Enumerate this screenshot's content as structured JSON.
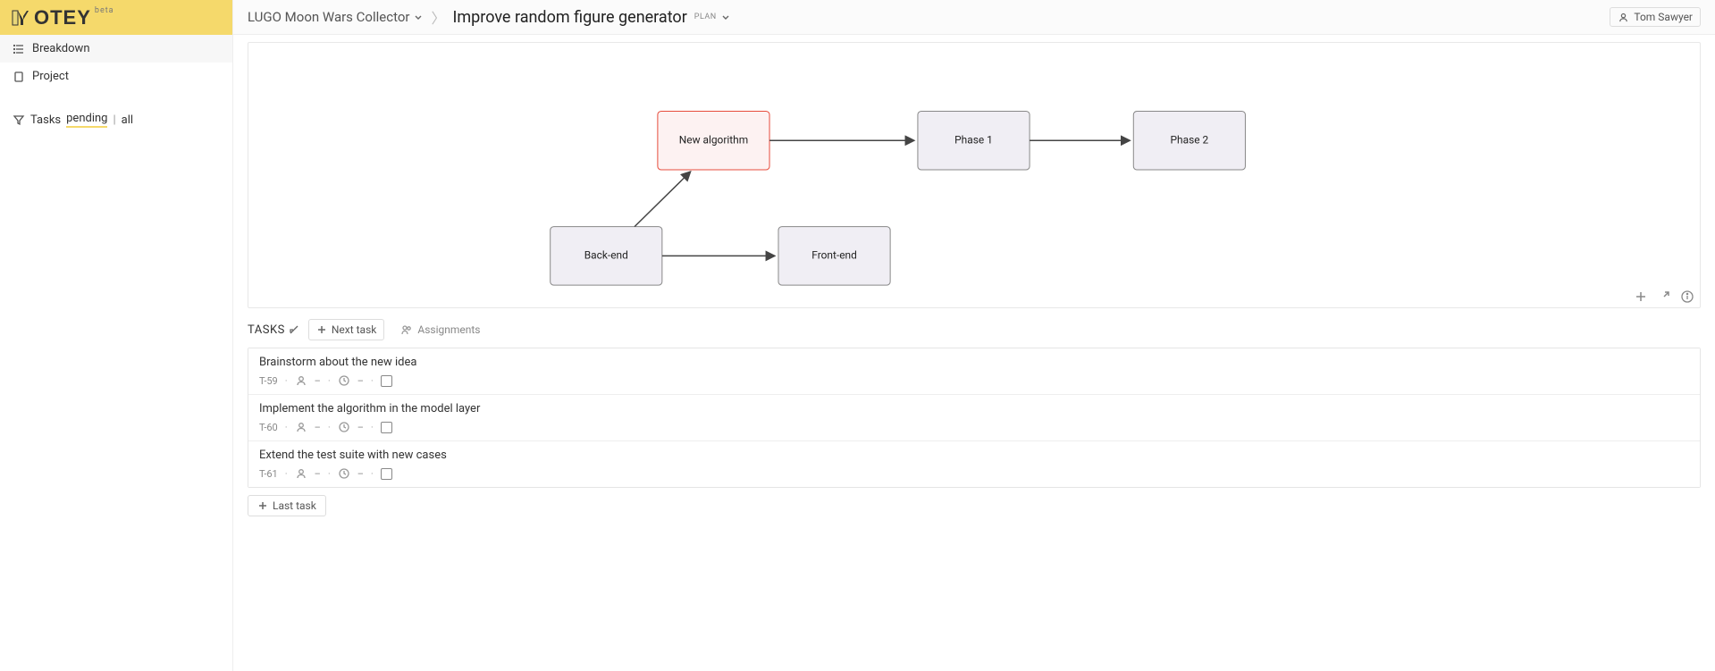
{
  "logo": {
    "text": "OTEY",
    "badge": "beta"
  },
  "sidebar": {
    "items": [
      {
        "label": "Breakdown"
      },
      {
        "label": "Project"
      }
    ],
    "tasks_filter": {
      "label": "Tasks",
      "option_pending": "pending",
      "option_all": "all",
      "divider": "|"
    }
  },
  "breadcrumb": {
    "project": "LUGO Moon Wars Collector",
    "plan": "Improve random figure generator",
    "plan_badge": "PLAN"
  },
  "user": {
    "name": "Tom Sawyer"
  },
  "diagram": {
    "nodes": {
      "backend": "Back-end",
      "frontend": "Front-end",
      "new_algorithm": "New algorithm",
      "phase1": "Phase 1",
      "phase2": "Phase 2"
    }
  },
  "tasks_panel": {
    "title": "TASKS",
    "next_task_btn": "Next task",
    "assignments_btn": "Assignments",
    "last_task_btn": "Last task",
    "dash": "–"
  },
  "tasks": [
    {
      "title": "Brainstorm about the new idea",
      "id": "T-59"
    },
    {
      "title": "Implement the algorithm in the model layer",
      "id": "T-60"
    },
    {
      "title": "Extend the test suite with new cases",
      "id": "T-61"
    }
  ]
}
